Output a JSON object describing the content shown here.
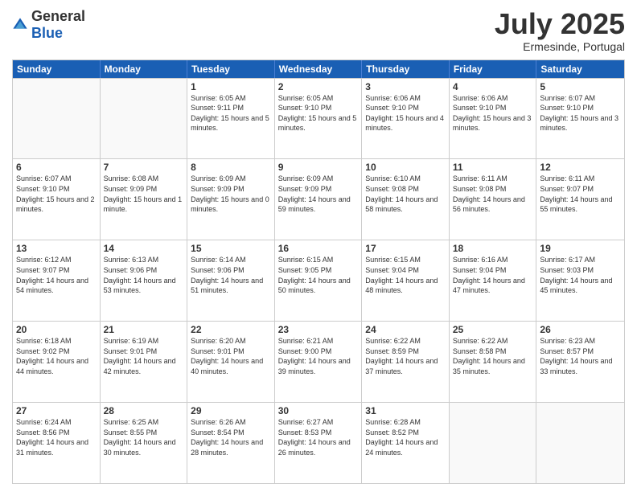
{
  "header": {
    "logo_general": "General",
    "logo_blue": "Blue",
    "title": "July 2025",
    "location": "Ermesinde, Portugal"
  },
  "weekdays": [
    "Sunday",
    "Monday",
    "Tuesday",
    "Wednesday",
    "Thursday",
    "Friday",
    "Saturday"
  ],
  "weeks": [
    [
      {
        "day": "",
        "empty": true
      },
      {
        "day": "",
        "empty": true
      },
      {
        "day": "1",
        "sunrise": "6:05 AM",
        "sunset": "9:11 PM",
        "daylight": "15 hours and 5 minutes."
      },
      {
        "day": "2",
        "sunrise": "6:05 AM",
        "sunset": "9:10 PM",
        "daylight": "15 hours and 5 minutes."
      },
      {
        "day": "3",
        "sunrise": "6:06 AM",
        "sunset": "9:10 PM",
        "daylight": "15 hours and 4 minutes."
      },
      {
        "day": "4",
        "sunrise": "6:06 AM",
        "sunset": "9:10 PM",
        "daylight": "15 hours and 3 minutes."
      },
      {
        "day": "5",
        "sunrise": "6:07 AM",
        "sunset": "9:10 PM",
        "daylight": "15 hours and 3 minutes."
      }
    ],
    [
      {
        "day": "6",
        "sunrise": "6:07 AM",
        "sunset": "9:10 PM",
        "daylight": "15 hours and 2 minutes."
      },
      {
        "day": "7",
        "sunrise": "6:08 AM",
        "sunset": "9:09 PM",
        "daylight": "15 hours and 1 minute."
      },
      {
        "day": "8",
        "sunrise": "6:09 AM",
        "sunset": "9:09 PM",
        "daylight": "15 hours and 0 minutes."
      },
      {
        "day": "9",
        "sunrise": "6:09 AM",
        "sunset": "9:09 PM",
        "daylight": "14 hours and 59 minutes."
      },
      {
        "day": "10",
        "sunrise": "6:10 AM",
        "sunset": "9:08 PM",
        "daylight": "14 hours and 58 minutes."
      },
      {
        "day": "11",
        "sunrise": "6:11 AM",
        "sunset": "9:08 PM",
        "daylight": "14 hours and 56 minutes."
      },
      {
        "day": "12",
        "sunrise": "6:11 AM",
        "sunset": "9:07 PM",
        "daylight": "14 hours and 55 minutes."
      }
    ],
    [
      {
        "day": "13",
        "sunrise": "6:12 AM",
        "sunset": "9:07 PM",
        "daylight": "14 hours and 54 minutes."
      },
      {
        "day": "14",
        "sunrise": "6:13 AM",
        "sunset": "9:06 PM",
        "daylight": "14 hours and 53 minutes."
      },
      {
        "day": "15",
        "sunrise": "6:14 AM",
        "sunset": "9:06 PM",
        "daylight": "14 hours and 51 minutes."
      },
      {
        "day": "16",
        "sunrise": "6:15 AM",
        "sunset": "9:05 PM",
        "daylight": "14 hours and 50 minutes."
      },
      {
        "day": "17",
        "sunrise": "6:15 AM",
        "sunset": "9:04 PM",
        "daylight": "14 hours and 48 minutes."
      },
      {
        "day": "18",
        "sunrise": "6:16 AM",
        "sunset": "9:04 PM",
        "daylight": "14 hours and 47 minutes."
      },
      {
        "day": "19",
        "sunrise": "6:17 AM",
        "sunset": "9:03 PM",
        "daylight": "14 hours and 45 minutes."
      }
    ],
    [
      {
        "day": "20",
        "sunrise": "6:18 AM",
        "sunset": "9:02 PM",
        "daylight": "14 hours and 44 minutes."
      },
      {
        "day": "21",
        "sunrise": "6:19 AM",
        "sunset": "9:01 PM",
        "daylight": "14 hours and 42 minutes."
      },
      {
        "day": "22",
        "sunrise": "6:20 AM",
        "sunset": "9:01 PM",
        "daylight": "14 hours and 40 minutes."
      },
      {
        "day": "23",
        "sunrise": "6:21 AM",
        "sunset": "9:00 PM",
        "daylight": "14 hours and 39 minutes."
      },
      {
        "day": "24",
        "sunrise": "6:22 AM",
        "sunset": "8:59 PM",
        "daylight": "14 hours and 37 minutes."
      },
      {
        "day": "25",
        "sunrise": "6:22 AM",
        "sunset": "8:58 PM",
        "daylight": "14 hours and 35 minutes."
      },
      {
        "day": "26",
        "sunrise": "6:23 AM",
        "sunset": "8:57 PM",
        "daylight": "14 hours and 33 minutes."
      }
    ],
    [
      {
        "day": "27",
        "sunrise": "6:24 AM",
        "sunset": "8:56 PM",
        "daylight": "14 hours and 31 minutes."
      },
      {
        "day": "28",
        "sunrise": "6:25 AM",
        "sunset": "8:55 PM",
        "daylight": "14 hours and 30 minutes."
      },
      {
        "day": "29",
        "sunrise": "6:26 AM",
        "sunset": "8:54 PM",
        "daylight": "14 hours and 28 minutes."
      },
      {
        "day": "30",
        "sunrise": "6:27 AM",
        "sunset": "8:53 PM",
        "daylight": "14 hours and 26 minutes."
      },
      {
        "day": "31",
        "sunrise": "6:28 AM",
        "sunset": "8:52 PM",
        "daylight": "14 hours and 24 minutes."
      },
      {
        "day": "",
        "empty": true
      },
      {
        "day": "",
        "empty": true
      }
    ]
  ],
  "labels": {
    "sunrise": "Sunrise:",
    "sunset": "Sunset:",
    "daylight": "Daylight:"
  }
}
